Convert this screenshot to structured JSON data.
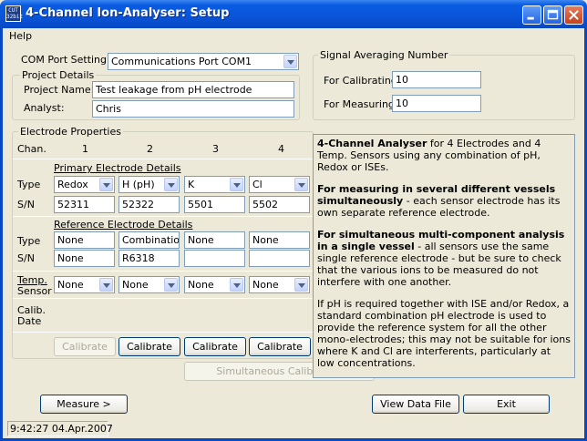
{
  "window": {
    "title": "4-Channel Ion-Analyser: Setup",
    "icon_text": "CUT 32bit"
  },
  "menu": {
    "help": "Help"
  },
  "com_port": {
    "label": "COM Port Setting:",
    "value": "Communications Port COM1"
  },
  "project": {
    "group_title": "Project Details",
    "name_label": "Project Name:",
    "name_value": "Test leakage from pH electrode",
    "analyst_label": "Analyst:",
    "analyst_value": "Chris"
  },
  "averaging": {
    "group_title": "Signal Averaging Number",
    "calibrating_label": "For Calibrating:",
    "calibrating_value": "10",
    "measuring_label": "For Measuring:",
    "measuring_value": "10"
  },
  "electrodes": {
    "group_title": "Electrode Properties",
    "chan_label": "Chan.",
    "channels": [
      "1",
      "2",
      "3",
      "4"
    ],
    "primary_title": "Primary Electrode Details",
    "type_label": "Type",
    "sn_label": "S/N",
    "primary_types": [
      "Redox",
      "H (pH)",
      "K",
      "Cl"
    ],
    "primary_sn": [
      "52311",
      "52322",
      "5501",
      "5502"
    ],
    "reference_title": "Reference Electrode Details",
    "reference_types": [
      "None",
      "Combination",
      "None",
      "None"
    ],
    "reference_sn": [
      "None",
      "R6318",
      "",
      ""
    ],
    "temp_label_1": "Temp.",
    "temp_label_2": "Sensor",
    "temp_sensors": [
      "None",
      "None",
      "None",
      "None"
    ],
    "calib_label_1": "Calib.",
    "calib_label_2": "Date",
    "calibrate_label": "Calibrate",
    "simultaneous_label": "Simultaneous Calibration"
  },
  "info": {
    "p1_bold": "4-Channel Analyser",
    "p1_text": " for 4 Electrodes and 4 Temp. Sensors using any combination of pH, Redox or ISEs.",
    "p2_bold": "For measuring in several different vessels simultaneously",
    "p2_text": " - each sensor electrode has its own separate reference electrode.",
    "p3_bold": "For simultaneous multi-component analysis in a single vessel",
    "p3_text": " - all sensors use the same single reference electrode - but be sure to check that the various ions to be measured do not interfere with one another.",
    "p4_text": "If pH is required together with ISE and/or Redox, a standard combination pH electrode is used to provide the reference system for all the other mono-electrodes; this may not be suitable for ions where K and Cl are interferents, particularly at low concentrations."
  },
  "buttons": {
    "measure": "Measure >",
    "view_data": "View Data File",
    "exit": "Exit"
  },
  "status": {
    "timestamp": "9:42:27 04.Apr.2007"
  }
}
